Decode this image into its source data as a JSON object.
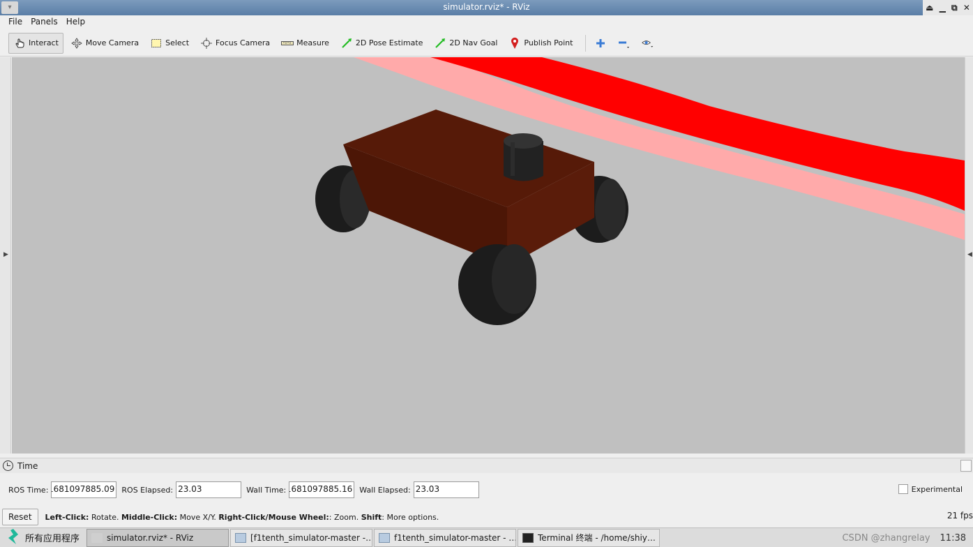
{
  "window": {
    "title": "simulator.rviz* - RViz",
    "app_icon": "rviz-icon",
    "controls": [
      "restore-up-icon",
      "minimize-icon",
      "maximize-icon",
      "close-icon"
    ]
  },
  "menu": {
    "items": [
      {
        "label": "File"
      },
      {
        "label": "Panels"
      },
      {
        "label": "Help"
      }
    ]
  },
  "toolbar": {
    "tools": [
      {
        "label": "Interact",
        "icon": "hand-pointer-icon",
        "active": true
      },
      {
        "label": "Move Camera",
        "icon": "move-arrows-icon"
      },
      {
        "label": "Select",
        "icon": "select-box-icon"
      },
      {
        "label": "Focus Camera",
        "icon": "focus-crosshair-icon"
      },
      {
        "label": "Measure",
        "icon": "ruler-icon"
      },
      {
        "label": "2D Pose Estimate",
        "icon": "green-arrow-icon"
      },
      {
        "label": "2D Nav Goal",
        "icon": "green-arrow-icon"
      },
      {
        "label": "Publish Point",
        "icon": "map-pin-icon"
      }
    ],
    "extra_icons": [
      "plus-icon",
      "minus-icon",
      "eye-icon"
    ],
    "colors": {
      "accent_green": "#22bb22",
      "pin_red": "#d32020",
      "blue": "#3a7bd5"
    }
  },
  "viewport": {
    "background": "#c0c0c0",
    "laser_scan_color": "#ff0000",
    "laser_scan_fade_color": "#ffaaaa",
    "car_body_color": "#561a08",
    "wheel_color": "#1c1c1c"
  },
  "time_panel": {
    "title": "Time",
    "ros_time_label": "ROS Time:",
    "ros_time_value": "1681097885.09",
    "ros_elapsed_label": "ROS Elapsed:",
    "ros_elapsed_value": "23.03",
    "wall_time_label": "Wall Time:",
    "wall_time_value": "1681097885.16",
    "wall_elapsed_label": "Wall Elapsed:",
    "wall_elapsed_value": "23.03",
    "experimental_label": "Experimental"
  },
  "status": {
    "reset_label": "Reset",
    "left_click_key": "Left-Click:",
    "left_click_desc": " Rotate. ",
    "middle_click_key": "Middle-Click:",
    "middle_click_desc": " Move X/Y. ",
    "right_click_key": "Right-Click/Mouse Wheel:",
    "right_click_desc": ": Zoom. ",
    "shift_key": "Shift",
    "shift_desc": ": More options.",
    "fps": "21 fps"
  },
  "taskbar": {
    "start_label": "所有应用程序",
    "tasks": [
      {
        "label": "simulator.rviz* - RViz",
        "icon": "rviz-icon",
        "active": true
      },
      {
        "label": "[f1tenth_simulator-master -…",
        "icon": "folder-icon"
      },
      {
        "label": "f1tenth_simulator-master - …",
        "icon": "folder-icon"
      },
      {
        "label": "Terminal 终端 - /home/shiy…",
        "icon": "terminal-icon"
      }
    ],
    "watermark": "CSDN @zhangrelay",
    "clock": "11:38"
  }
}
